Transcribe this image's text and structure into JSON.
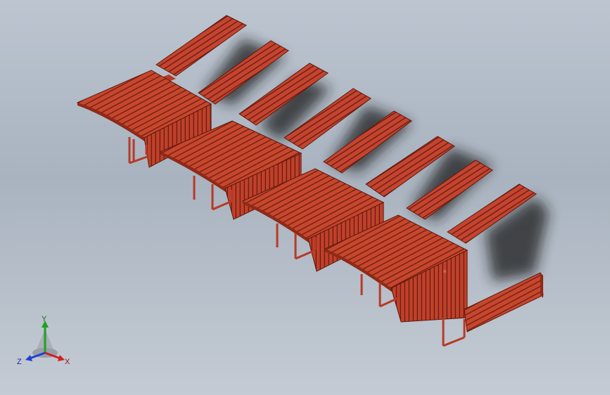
{
  "viewport": {
    "background_top": "#bcc5d0",
    "background_bottom": "#c4cbd4",
    "model_color": "#c0402a",
    "model_dark": "#7a2416",
    "model_light": "#d9583c",
    "shadow_color": "#1c1c1c"
  },
  "triad": {
    "y_label": "Y",
    "x_label": "X",
    "z_label": "Z",
    "y_color": "#20a020",
    "x_color": "#d02020",
    "z_color": "#2040d0"
  }
}
